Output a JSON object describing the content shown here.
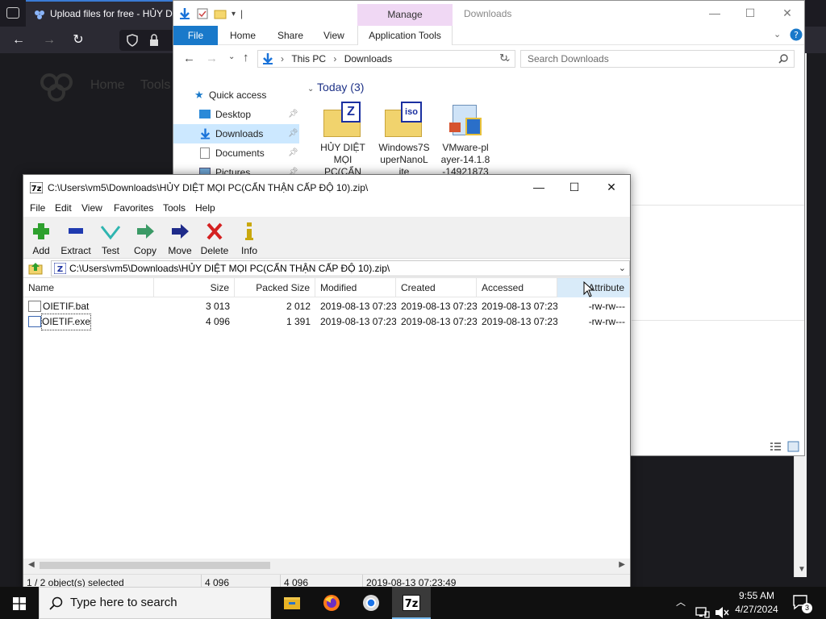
{
  "browser": {
    "tab_title": "Upload files for free - HỦY DIỆT",
    "site_nav": [
      "Home",
      "Tools"
    ]
  },
  "explorer": {
    "quick_access_hint": "|",
    "manage_label": "Manage",
    "window_title": "Downloads",
    "ribbon_tabs": [
      "File",
      "Home",
      "Share",
      "View",
      "Application Tools"
    ],
    "breadcrumb": [
      "This PC",
      "Downloads"
    ],
    "search_placeholder": "Search Downloads",
    "nav_items": [
      {
        "label": "Quick access"
      },
      {
        "label": "Desktop"
      },
      {
        "label": "Downloads"
      },
      {
        "label": "Documents"
      },
      {
        "label": "Pictures"
      }
    ],
    "group_label": "Today (3)",
    "files": [
      {
        "name_line1": "HỦY DIỆT",
        "name_line2": "MỌI",
        "name_line3": "PC(CẨN"
      },
      {
        "name_line1": "Windows7S",
        "name_line2": "uperNanoL",
        "name_line3": "ite"
      },
      {
        "name_line1": "VMware-pl",
        "name_line2": "ayer-14.1.8",
        "name_line3": "-14921873"
      }
    ]
  },
  "zip": {
    "title": "C:\\Users\\vm5\\Downloads\\HỦY DIỆT MỌI PC(CẨN THẬN CẤP ĐỘ 10).zip\\",
    "menu": [
      "File",
      "Edit",
      "View",
      "Favorites",
      "Tools",
      "Help"
    ],
    "toolbar": [
      "Add",
      "Extract",
      "Test",
      "Copy",
      "Move",
      "Delete",
      "Info"
    ],
    "path": "C:\\Users\\vm5\\Downloads\\HỦY DIỆT MỌI PC(CẨN THẬN CẤP ĐỘ 10).zip\\",
    "columns": [
      "Name",
      "Size",
      "Packed Size",
      "Modified",
      "Created",
      "Accessed",
      "Attribute"
    ],
    "rows": [
      {
        "name": "OIETIF.bat",
        "size": "3 013",
        "packed": "2 012",
        "modified": "2019-08-13 07:23",
        "created": "2019-08-13 07:23",
        "accessed": "2019-08-13 07:23",
        "attr": "-rw-rw---"
      },
      {
        "name": "OIETIF.exe",
        "size": "4 096",
        "packed": "1 391",
        "modified": "2019-08-13 07:23",
        "created": "2019-08-13 07:23",
        "accessed": "2019-08-13 07:23",
        "attr": "-rw-rw---"
      }
    ],
    "status": {
      "selection": "1 / 2 object(s) selected",
      "size": "4 096",
      "packed": "4 096",
      "modified": "2019-08-13 07:23:49"
    }
  },
  "taskbar": {
    "search_placeholder": "Type here to search",
    "time": "9:55 AM",
    "date": "4/27/2024",
    "notifications": "3"
  }
}
